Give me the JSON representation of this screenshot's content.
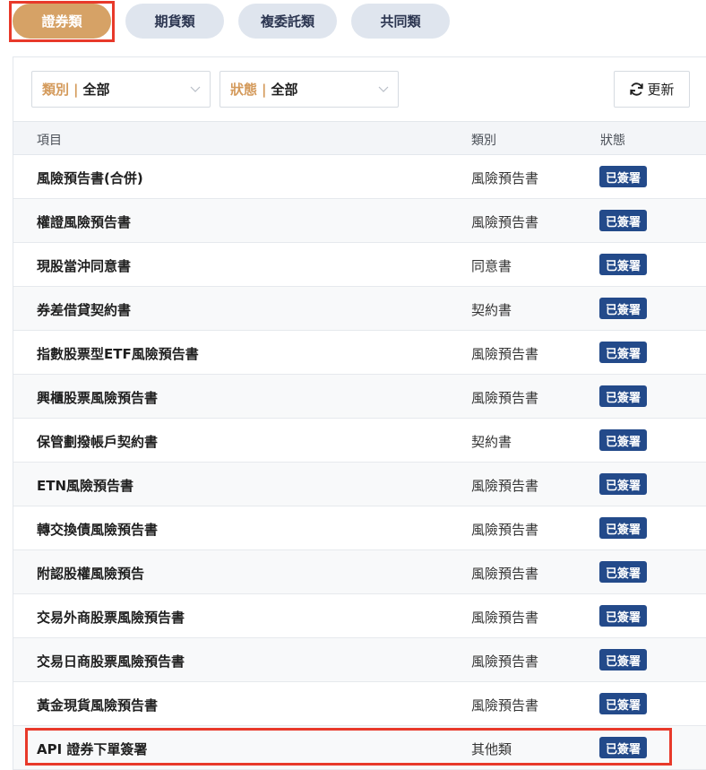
{
  "tabs": [
    {
      "label": "證券類",
      "active": true
    },
    {
      "label": "期貨類",
      "active": false
    },
    {
      "label": "複委託類",
      "active": false
    },
    {
      "label": "共同類",
      "active": false
    }
  ],
  "filters": {
    "category": {
      "label": "類別",
      "separator": "|",
      "value": "全部"
    },
    "status": {
      "label": "狀態",
      "separator": "|",
      "value": "全部"
    }
  },
  "refresh_button": {
    "label": "更新",
    "icon": "refresh-icon"
  },
  "table": {
    "headers": {
      "item": "項目",
      "category": "類別",
      "status": "狀態"
    },
    "rows": [
      {
        "item": "風險預告書(合併)",
        "category": "風險預告書",
        "status": "已簽署"
      },
      {
        "item": "權證風險預告書",
        "category": "風險預告書",
        "status": "已簽署"
      },
      {
        "item": "現股當沖同意書",
        "category": "同意書",
        "status": "已簽署"
      },
      {
        "item": "券差借貸契約書",
        "category": "契約書",
        "status": "已簽署"
      },
      {
        "item": "指數股票型ETF風險預告書",
        "category": "風險預告書",
        "status": "已簽署"
      },
      {
        "item": "興櫃股票風險預告書",
        "category": "風險預告書",
        "status": "已簽署"
      },
      {
        "item": "保管劃撥帳戶契約書",
        "category": "契約書",
        "status": "已簽署"
      },
      {
        "item": "ETN風險預告書",
        "category": "風險預告書",
        "status": "已簽署"
      },
      {
        "item": "轉交換債風險預告書",
        "category": "風險預告書",
        "status": "已簽署"
      },
      {
        "item": "附認股權風險預告",
        "category": "風險預告書",
        "status": "已簽署"
      },
      {
        "item": "交易外商股票風險預告書",
        "category": "風險預告書",
        "status": "已簽署"
      },
      {
        "item": "交易日商股票風險預告書",
        "category": "風險預告書",
        "status": "已簽署"
      },
      {
        "item": "黃金現貨風險預告書",
        "category": "風險預告書",
        "status": "已簽署"
      },
      {
        "item": "API 證券下單簽署",
        "category": "其他類",
        "status": "已簽署"
      }
    ]
  },
  "colors": {
    "active_tab": "#d6a266",
    "inactive_tab": "#dfe5ee",
    "badge": "#234a8a",
    "filter_label": "#d49a5b",
    "highlight": "#e8392a"
  }
}
